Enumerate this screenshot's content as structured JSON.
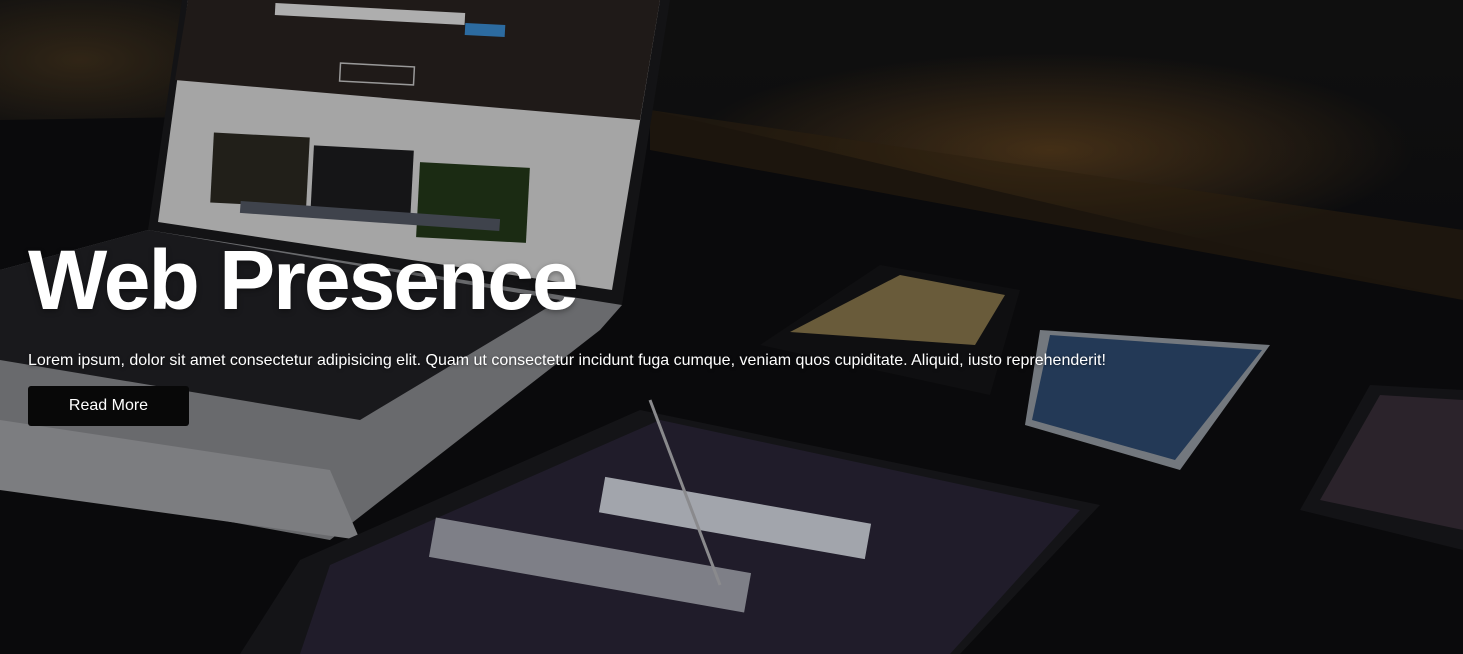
{
  "hero": {
    "title": "Web Presence",
    "description": "Lorem ipsum, dolor sit amet consectetur adipisicing elit. Quam ut consectetur incidunt fuga cumque, veniam quos cupiditate. Aliquid, iusto reprehenderit!",
    "button_label": "Read More",
    "background_image": "devices-photo",
    "colors": {
      "text": "#ffffff",
      "button_bg": "#080808",
      "overlay": "#000000"
    }
  }
}
